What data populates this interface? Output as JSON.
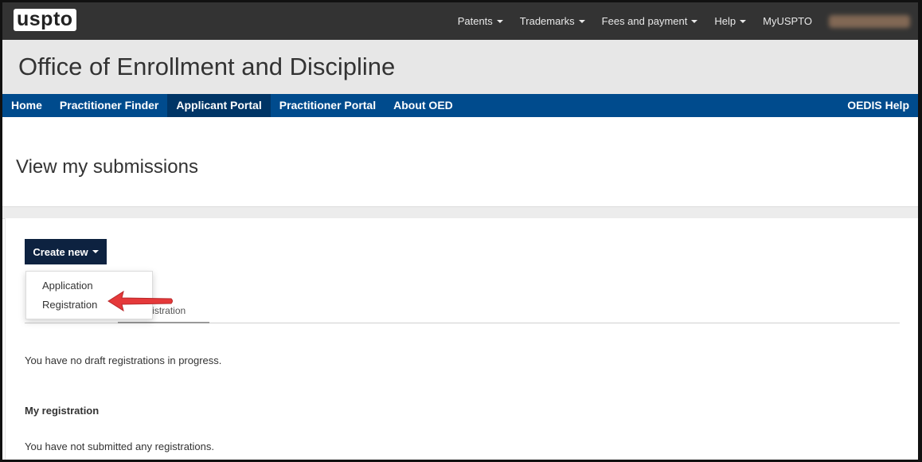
{
  "brand": {
    "logo_text": "uspto"
  },
  "topnav": {
    "items": [
      {
        "label": "Patents",
        "has_caret": true
      },
      {
        "label": "Trademarks",
        "has_caret": true
      },
      {
        "label": "Fees and payment",
        "has_caret": true
      },
      {
        "label": "Help",
        "has_caret": true
      },
      {
        "label": "MyUSPTO",
        "has_caret": false
      }
    ]
  },
  "site": {
    "title": "Office of Enrollment and Discipline"
  },
  "mainnav": {
    "items": [
      "Home",
      "Practitioner Finder",
      "Applicant Portal",
      "Practitioner Portal",
      "About OED"
    ],
    "active": "Applicant Portal",
    "help": "OEDIS Help"
  },
  "page": {
    "heading": "View my submissions",
    "create_button": "Create new",
    "dropdown": [
      "Application",
      "Registration"
    ],
    "tab_partial": "egistration",
    "no_drafts": "You have no draft registrations in progress.",
    "section_title": "My registration",
    "no_submitted": "You have not submitted any registrations."
  },
  "colors": {
    "topbar": "#333333",
    "nav_blue": "#004b8d",
    "nav_active": "#003566",
    "button": "#0d2240",
    "arrow": "#e5393a"
  }
}
